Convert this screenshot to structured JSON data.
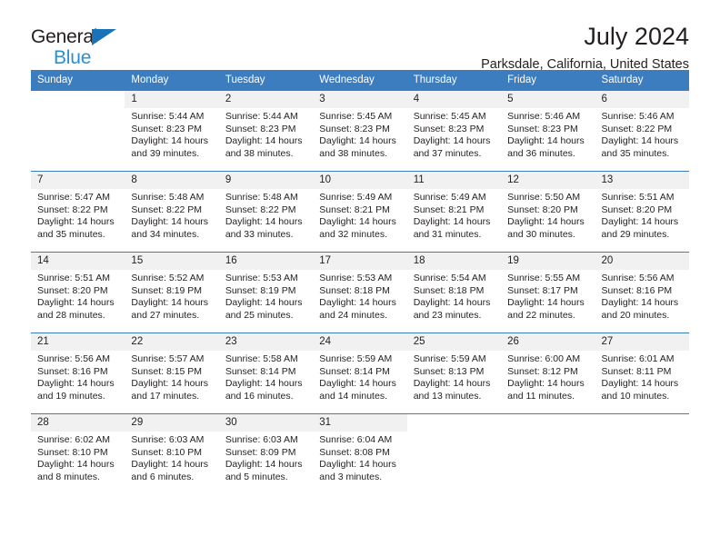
{
  "brand": {
    "line1": "General",
    "line2": "Blue",
    "triangle_color": "#1a73b8",
    "line2_color": "#2a8fd4"
  },
  "header": {
    "title": "July 2024",
    "location": "Parksdale, California, United States"
  },
  "calendar": {
    "header_bg": "#3b7dbf",
    "daynum_bg": "#f1f1f1",
    "weekdays": [
      "Sunday",
      "Monday",
      "Tuesday",
      "Wednesday",
      "Thursday",
      "Friday",
      "Saturday"
    ],
    "weeks": [
      [
        {
          "day": "",
          "sunrise": "",
          "sunset": "",
          "daylight1": "",
          "daylight2": ""
        },
        {
          "day": "1",
          "sunrise": "Sunrise: 5:44 AM",
          "sunset": "Sunset: 8:23 PM",
          "daylight1": "Daylight: 14 hours",
          "daylight2": "and 39 minutes."
        },
        {
          "day": "2",
          "sunrise": "Sunrise: 5:44 AM",
          "sunset": "Sunset: 8:23 PM",
          "daylight1": "Daylight: 14 hours",
          "daylight2": "and 38 minutes."
        },
        {
          "day": "3",
          "sunrise": "Sunrise: 5:45 AM",
          "sunset": "Sunset: 8:23 PM",
          "daylight1": "Daylight: 14 hours",
          "daylight2": "and 38 minutes."
        },
        {
          "day": "4",
          "sunrise": "Sunrise: 5:45 AM",
          "sunset": "Sunset: 8:23 PM",
          "daylight1": "Daylight: 14 hours",
          "daylight2": "and 37 minutes."
        },
        {
          "day": "5",
          "sunrise": "Sunrise: 5:46 AM",
          "sunset": "Sunset: 8:23 PM",
          "daylight1": "Daylight: 14 hours",
          "daylight2": "and 36 minutes."
        },
        {
          "day": "6",
          "sunrise": "Sunrise: 5:46 AM",
          "sunset": "Sunset: 8:22 PM",
          "daylight1": "Daylight: 14 hours",
          "daylight2": "and 35 minutes."
        }
      ],
      [
        {
          "day": "7",
          "sunrise": "Sunrise: 5:47 AM",
          "sunset": "Sunset: 8:22 PM",
          "daylight1": "Daylight: 14 hours",
          "daylight2": "and 35 minutes."
        },
        {
          "day": "8",
          "sunrise": "Sunrise: 5:48 AM",
          "sunset": "Sunset: 8:22 PM",
          "daylight1": "Daylight: 14 hours",
          "daylight2": "and 34 minutes."
        },
        {
          "day": "9",
          "sunrise": "Sunrise: 5:48 AM",
          "sunset": "Sunset: 8:22 PM",
          "daylight1": "Daylight: 14 hours",
          "daylight2": "and 33 minutes."
        },
        {
          "day": "10",
          "sunrise": "Sunrise: 5:49 AM",
          "sunset": "Sunset: 8:21 PM",
          "daylight1": "Daylight: 14 hours",
          "daylight2": "and 32 minutes."
        },
        {
          "day": "11",
          "sunrise": "Sunrise: 5:49 AM",
          "sunset": "Sunset: 8:21 PM",
          "daylight1": "Daylight: 14 hours",
          "daylight2": "and 31 minutes."
        },
        {
          "day": "12",
          "sunrise": "Sunrise: 5:50 AM",
          "sunset": "Sunset: 8:20 PM",
          "daylight1": "Daylight: 14 hours",
          "daylight2": "and 30 minutes."
        },
        {
          "day": "13",
          "sunrise": "Sunrise: 5:51 AM",
          "sunset": "Sunset: 8:20 PM",
          "daylight1": "Daylight: 14 hours",
          "daylight2": "and 29 minutes."
        }
      ],
      [
        {
          "day": "14",
          "sunrise": "Sunrise: 5:51 AM",
          "sunset": "Sunset: 8:20 PM",
          "daylight1": "Daylight: 14 hours",
          "daylight2": "and 28 minutes."
        },
        {
          "day": "15",
          "sunrise": "Sunrise: 5:52 AM",
          "sunset": "Sunset: 8:19 PM",
          "daylight1": "Daylight: 14 hours",
          "daylight2": "and 27 minutes."
        },
        {
          "day": "16",
          "sunrise": "Sunrise: 5:53 AM",
          "sunset": "Sunset: 8:19 PM",
          "daylight1": "Daylight: 14 hours",
          "daylight2": "and 25 minutes."
        },
        {
          "day": "17",
          "sunrise": "Sunrise: 5:53 AM",
          "sunset": "Sunset: 8:18 PM",
          "daylight1": "Daylight: 14 hours",
          "daylight2": "and 24 minutes."
        },
        {
          "day": "18",
          "sunrise": "Sunrise: 5:54 AM",
          "sunset": "Sunset: 8:18 PM",
          "daylight1": "Daylight: 14 hours",
          "daylight2": "and 23 minutes."
        },
        {
          "day": "19",
          "sunrise": "Sunrise: 5:55 AM",
          "sunset": "Sunset: 8:17 PM",
          "daylight1": "Daylight: 14 hours",
          "daylight2": "and 22 minutes."
        },
        {
          "day": "20",
          "sunrise": "Sunrise: 5:56 AM",
          "sunset": "Sunset: 8:16 PM",
          "daylight1": "Daylight: 14 hours",
          "daylight2": "and 20 minutes."
        }
      ],
      [
        {
          "day": "21",
          "sunrise": "Sunrise: 5:56 AM",
          "sunset": "Sunset: 8:16 PM",
          "daylight1": "Daylight: 14 hours",
          "daylight2": "and 19 minutes."
        },
        {
          "day": "22",
          "sunrise": "Sunrise: 5:57 AM",
          "sunset": "Sunset: 8:15 PM",
          "daylight1": "Daylight: 14 hours",
          "daylight2": "and 17 minutes."
        },
        {
          "day": "23",
          "sunrise": "Sunrise: 5:58 AM",
          "sunset": "Sunset: 8:14 PM",
          "daylight1": "Daylight: 14 hours",
          "daylight2": "and 16 minutes."
        },
        {
          "day": "24",
          "sunrise": "Sunrise: 5:59 AM",
          "sunset": "Sunset: 8:14 PM",
          "daylight1": "Daylight: 14 hours",
          "daylight2": "and 14 minutes."
        },
        {
          "day": "25",
          "sunrise": "Sunrise: 5:59 AM",
          "sunset": "Sunset: 8:13 PM",
          "daylight1": "Daylight: 14 hours",
          "daylight2": "and 13 minutes."
        },
        {
          "day": "26",
          "sunrise": "Sunrise: 6:00 AM",
          "sunset": "Sunset: 8:12 PM",
          "daylight1": "Daylight: 14 hours",
          "daylight2": "and 11 minutes."
        },
        {
          "day": "27",
          "sunrise": "Sunrise: 6:01 AM",
          "sunset": "Sunset: 8:11 PM",
          "daylight1": "Daylight: 14 hours",
          "daylight2": "and 10 minutes."
        }
      ],
      [
        {
          "day": "28",
          "sunrise": "Sunrise: 6:02 AM",
          "sunset": "Sunset: 8:10 PM",
          "daylight1": "Daylight: 14 hours",
          "daylight2": "and 8 minutes."
        },
        {
          "day": "29",
          "sunrise": "Sunrise: 6:03 AM",
          "sunset": "Sunset: 8:10 PM",
          "daylight1": "Daylight: 14 hours",
          "daylight2": "and 6 minutes."
        },
        {
          "day": "30",
          "sunrise": "Sunrise: 6:03 AM",
          "sunset": "Sunset: 8:09 PM",
          "daylight1": "Daylight: 14 hours",
          "daylight2": "and 5 minutes."
        },
        {
          "day": "31",
          "sunrise": "Sunrise: 6:04 AM",
          "sunset": "Sunset: 8:08 PM",
          "daylight1": "Daylight: 14 hours",
          "daylight2": "and 3 minutes."
        },
        {
          "day": "",
          "sunrise": "",
          "sunset": "",
          "daylight1": "",
          "daylight2": ""
        },
        {
          "day": "",
          "sunrise": "",
          "sunset": "",
          "daylight1": "",
          "daylight2": ""
        },
        {
          "day": "",
          "sunrise": "",
          "sunset": "",
          "daylight1": "",
          "daylight2": ""
        }
      ]
    ]
  }
}
